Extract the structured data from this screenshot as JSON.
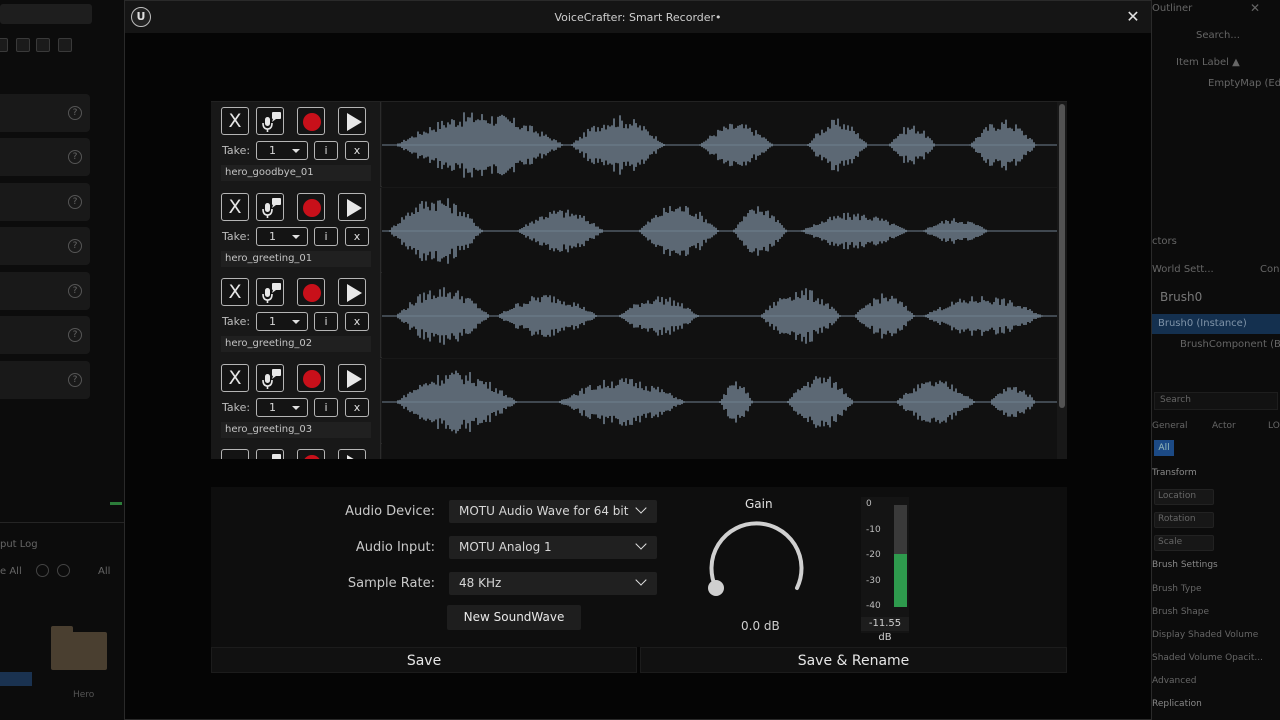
{
  "window": {
    "title": "VoiceCrafter: Smart Recorder•",
    "logo_text": "U",
    "close_glyph": "✕"
  },
  "tracks": [
    {
      "name": "hero_goodbye_01",
      "take": "1",
      "delete_glyph": "X",
      "info_glyph": "i",
      "remove_glyph": "x"
    },
    {
      "name": "hero_greeting_01",
      "take": "1",
      "delete_glyph": "X",
      "info_glyph": "i",
      "remove_glyph": "x"
    },
    {
      "name": "hero_greeting_02",
      "take": "1",
      "delete_glyph": "X",
      "info_glyph": "i",
      "remove_glyph": "x"
    },
    {
      "name": "hero_greeting_03",
      "take": "1",
      "delete_glyph": "X",
      "info_glyph": "i",
      "remove_glyph": "x"
    }
  ],
  "take_label": "Take:",
  "settings": {
    "audio_device_label": "Audio Device:",
    "audio_device_value": "MOTU Audio Wave for 64 bit",
    "audio_input_label": "Audio Input:",
    "audio_input_value": "MOTU Analog 1",
    "sample_rate_label": "Sample Rate:",
    "sample_rate_value": "48 KHz",
    "new_soundwave_label": "New SoundWave",
    "gain_label": "Gain",
    "gain_value": "0.0 dB",
    "meter_ticks": [
      "0",
      "-10",
      "-20",
      "-30",
      "-40"
    ],
    "meter_reading": "-11.55 dB",
    "meter_level_fraction": 0.52
  },
  "footer": {
    "save_label": "Save",
    "save_rename_label": "Save & Rename"
  },
  "background_left": {
    "output_log": "put Log",
    "all_a": "e All",
    "all_b": "All",
    "hero": "Hero"
  },
  "background_right": {
    "outliner": "Outliner",
    "search": "Search...",
    "item_label": "Item Label ▲",
    "empty_map": "EmptyMap (Edi",
    "actors": "ctors",
    "world_settings": "World Sett...",
    "con": "Con",
    "brush0": "Brush0",
    "brush0_instance": "Brush0 (Instance)",
    "brush_component": "BrushComponent (Br",
    "search2": "Search",
    "general": "General",
    "actor": "Actor",
    "lo": "LO",
    "all": "All",
    "transform": "Transform",
    "location": "Location",
    "rotation": "Rotation",
    "scale": "Scale",
    "brush_settings": "Brush Settings",
    "brush_type": "Brush Type",
    "brush_shape": "Brush Shape",
    "display_shaded": "Display Shaded Volume",
    "shaded_opacity": "Shaded Volume Opacit...",
    "advanced": "Advanced",
    "replication": "Replication"
  },
  "colors": {
    "record": "#c8101a",
    "waveform": "#6f7f8e",
    "meter_fill": "#2e9a4d",
    "selection": "#14304f"
  }
}
